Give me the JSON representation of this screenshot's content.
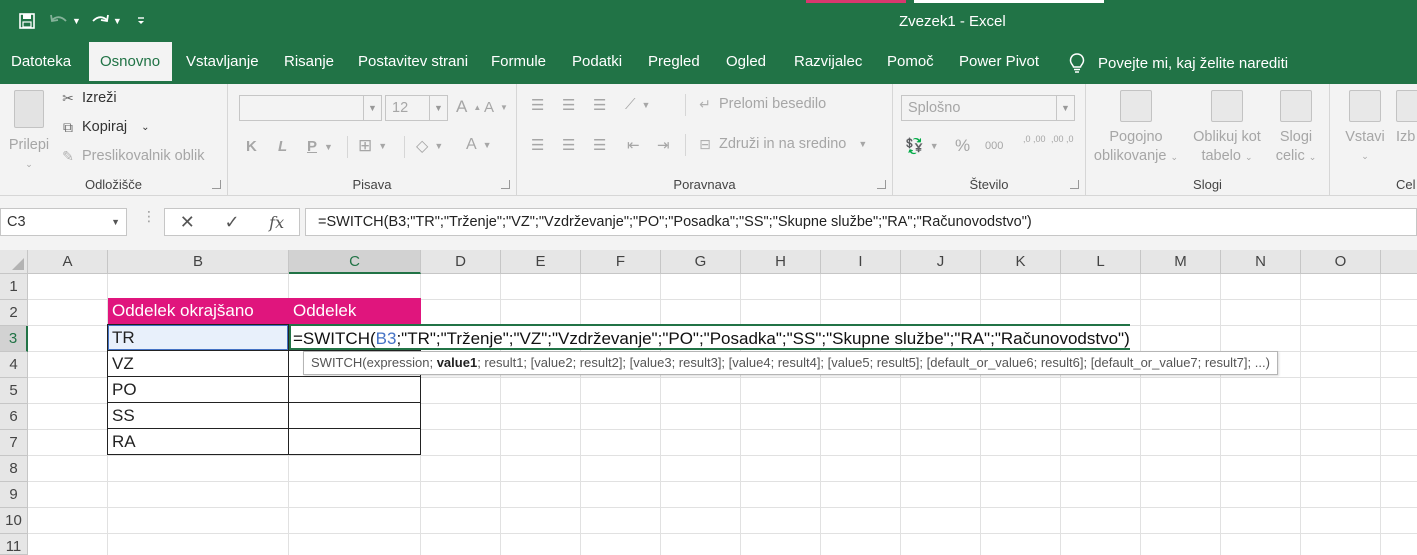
{
  "window": {
    "title": "Zvezek1  -  Excel",
    "title_bar_color": "#217346",
    "accent_pink": "#d9376e"
  },
  "qat": {
    "save_icon": "save-icon",
    "undo_icon": "undo-icon",
    "redo_icon": "redo-icon",
    "customize_icon": "customize-qat-icon"
  },
  "tabs": [
    {
      "label": "Datoteka"
    },
    {
      "label": "Osnovno"
    },
    {
      "label": "Vstavljanje"
    },
    {
      "label": "Risanje"
    },
    {
      "label": "Postavitev strani"
    },
    {
      "label": "Formule"
    },
    {
      "label": "Podatki"
    },
    {
      "label": "Pregled"
    },
    {
      "label": "Ogled"
    },
    {
      "label": "Razvijalec"
    },
    {
      "label": "Pomoč"
    },
    {
      "label": "Power Pivot"
    }
  ],
  "active_tab": "Osnovno",
  "tell_me": "Povejte mi, kaj želite narediti",
  "ribbon": {
    "clipboard": {
      "label": "Odložišče",
      "paste": "Prilepi",
      "cut": "Izreži",
      "copy": "Kopiraj",
      "format_painter": "Preslikovalnik oblik"
    },
    "font": {
      "label": "Pisava",
      "font_name": "",
      "font_size": "12",
      "bold": "K",
      "italic": "L",
      "underline": "P"
    },
    "alignment": {
      "label": "Poravnava",
      "wrap_text": "Prelomi besedilo",
      "merge_center": "Združi in na sredino"
    },
    "number": {
      "label": "Število",
      "format": "Splošno",
      "percent": "%",
      "thousands": "000",
      "inc_decimal": ",0 ,00",
      "dec_decimal": ",00 ,0"
    },
    "styles": {
      "label": "Slogi",
      "conditional_line1": "Pogojno",
      "conditional_line2": "oblikovanje",
      "format_table_line1": "Oblikuj kot",
      "format_table_line2": "tabelo",
      "cell_styles_line1": "Slogi",
      "cell_styles_line2": "celic"
    },
    "cells": {
      "label": "Cel",
      "insert": "Vstavi",
      "delete": "Izb"
    }
  },
  "formula_bar": {
    "name_box": "C3",
    "cancel_symbol": "✕",
    "enter_symbol": "✓",
    "fx_symbol": "fx",
    "formula": "=SWITCH(B3;\"TR\";\"Trženje\";\"VZ\";\"Vzdrževanje\";\"PO\";\"Posadka\";\"SS\";\"Skupne službe\";\"RA\";\"Računovodstvo\")"
  },
  "grid": {
    "columns": [
      "A",
      "B",
      "C",
      "D",
      "E",
      "F",
      "G",
      "H",
      "I",
      "J",
      "K",
      "L",
      "M",
      "N",
      "O"
    ],
    "rows": [
      "1",
      "2",
      "3",
      "4",
      "5",
      "6",
      "7",
      "8",
      "9",
      "10",
      "11"
    ],
    "selected_column": "C",
    "selected_row": "3",
    "header_fill": "#e0157d",
    "cells": {
      "B2": "Oddelek okrajšano",
      "C2": "Oddelek",
      "B3": "TR",
      "B4": "VZ",
      "B5": "PO",
      "B6": "SS",
      "B7": "RA"
    },
    "edit": {
      "prefix": "=SWITCH(",
      "ref": "B3",
      "suffix": ";\"TR\";\"Trženje\";\"VZ\";\"Vzdrževanje\";\"PO\";\"Posadka\";\"SS\";\"Skupne službe\";\"RA\";\"Računovodstvo\")",
      "ref_color": "#4472c4"
    },
    "tooltip": {
      "prefix": "SWITCH(expression; ",
      "bold": "value1",
      "suffix": "; result1; [value2; result2]; [value3; result3]; [value4; result4]; [value5; result5]; [default_or_value6; result6]; [default_or_value7; result7]; ...)"
    }
  }
}
